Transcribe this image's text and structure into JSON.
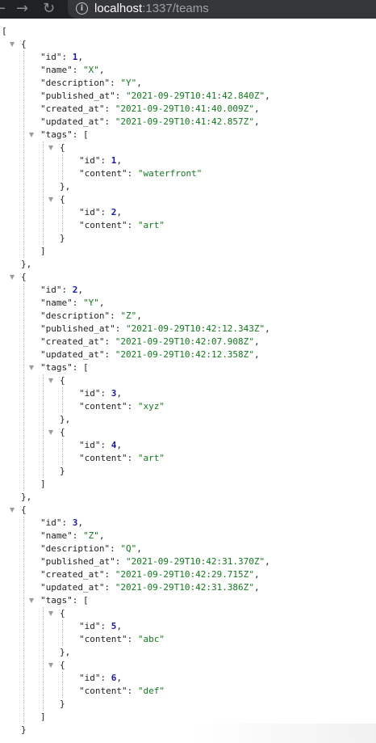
{
  "browser": {
    "back_icon": "arrow-left-icon",
    "forward_icon": "arrow-right-icon",
    "reload_icon": "reload-icon",
    "site_info_icon": "info-icon",
    "url_host": "localhost",
    "url_rest": ":1337/teams",
    "toolbar_color": "#202124",
    "urlbar_color": "#35363a"
  },
  "json_colors": {
    "key": "#202124",
    "string": "#0f7a1a",
    "number": "#1a1aa6"
  },
  "teams": [
    {
      "id": 1,
      "name": "X",
      "description": "Y",
      "published_at": "2021-09-29T10:41:42.840Z",
      "created_at": "2021-09-29T10:41:40.009Z",
      "updated_at": "2021-09-29T10:41:42.857Z",
      "tags": [
        {
          "id": 1,
          "content": "waterfront"
        },
        {
          "id": 2,
          "content": "art"
        }
      ]
    },
    {
      "id": 2,
      "name": "Y",
      "description": "Z",
      "published_at": "2021-09-29T10:42:12.343Z",
      "created_at": "2021-09-29T10:42:07.908Z",
      "updated_at": "2021-09-29T10:42:12.358Z",
      "tags": [
        {
          "id": 3,
          "content": "xyz"
        },
        {
          "id": 4,
          "content": "art"
        }
      ]
    },
    {
      "id": 3,
      "name": "Z",
      "description": "Q",
      "published_at": "2021-09-29T10:42:31.370Z",
      "created_at": "2021-09-29T10:42:29.715Z",
      "updated_at": "2021-09-29T10:42:31.386Z",
      "tags": [
        {
          "id": 5,
          "content": "abc"
        },
        {
          "id": 6,
          "content": "def"
        }
      ]
    }
  ]
}
